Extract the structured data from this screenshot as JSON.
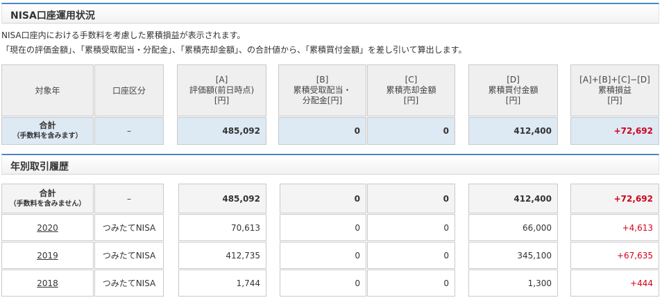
{
  "status_section": {
    "title": "NISA口座運用状況",
    "description_lines": [
      "NISA口座内における手数料を考慮した累積損益が表示されます。",
      "「現在の評価金額」、「累積受取配当・分配金」、「累積売却金額」、の合計値から、「累積買付金額」を差し引いて算出します。"
    ],
    "headers": {
      "year": "対象年",
      "account_type": "口座区分",
      "valuation": [
        "[A]",
        "評価額(前日時点)",
        "[円]"
      ],
      "dividends": [
        "[B]",
        "累積受取配当・",
        "分配金[円]"
      ],
      "sales": [
        "[C]",
        "累積売却金額",
        "[円]"
      ],
      "purchases": [
        "[D]",
        "累積買付金額",
        "[円]"
      ],
      "profit": [
        "[A]+[B]+[C]−[D]",
        "累積損益",
        "[円]"
      ]
    },
    "total_row": {
      "label": "合計",
      "note": "（手数料を含みます）",
      "account_type": "–",
      "valuation": "485,092",
      "dividends": "0",
      "sales": "0",
      "purchases": "412,400",
      "profit": "+72,692"
    }
  },
  "history_section": {
    "title": "年別取引履歴",
    "total_row": {
      "label": "合計",
      "note": "（手数料を含みません）",
      "account_type": "–",
      "valuation": "485,092",
      "dividends": "0",
      "sales": "0",
      "purchases": "412,400",
      "profit": "+72,692"
    },
    "rows": [
      {
        "year": "2020",
        "account_type": "つみたてNISA",
        "valuation": "70,613",
        "dividends": "0",
        "sales": "0",
        "purchases": "66,000",
        "profit": "+4,613"
      },
      {
        "year": "2019",
        "account_type": "つみたてNISA",
        "valuation": "412,735",
        "dividends": "0",
        "sales": "0",
        "purchases": "345,100",
        "profit": "+67,635"
      },
      {
        "year": "2018",
        "account_type": "つみたてNISA",
        "valuation": "1,744",
        "dividends": "0",
        "sales": "0",
        "purchases": "1,300",
        "profit": "+444"
      }
    ]
  },
  "colors": {
    "accent": "#4a86c5",
    "positive": "#d0021b",
    "total_bg": "#dde9f3",
    "header_bg": "#efefef"
  }
}
